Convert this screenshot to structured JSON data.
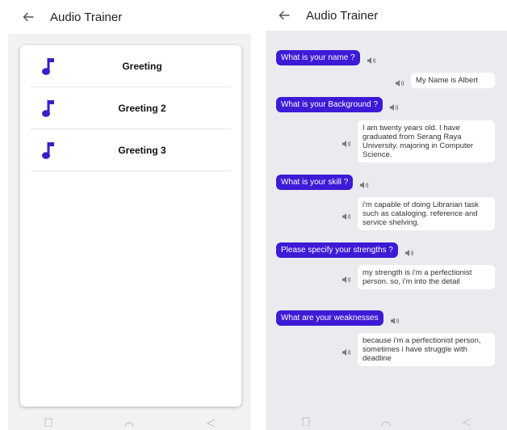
{
  "colors": {
    "accent": "#3d1ad6",
    "bubble_text": "#ffffff",
    "note_icon": "#3a1ec8"
  },
  "left_screen": {
    "title": "Audio Trainer",
    "back_icon": "arrow-left-icon",
    "items": [
      {
        "label": "Greeting",
        "icon": "music-note-icon"
      },
      {
        "label": "Greeting 2",
        "icon": "music-note-icon"
      },
      {
        "label": "Greeting 3",
        "icon": "music-note-icon"
      }
    ]
  },
  "right_screen": {
    "title": "Audio Trainer",
    "back_icon": "arrow-left-icon",
    "speaker_icon": "speaker-icon",
    "dialog": [
      {
        "question": "What is your name ?",
        "answer": "My Name is Albert"
      },
      {
        "question": "What is your Background ?",
        "answer": "I am twenty  years old. I have graduated from Serang Raya University. majoring in Computer Science."
      },
      {
        "question": "What is your skill ?",
        "answer": "i'm capable of doing Librarian task such as cataloging. reference and service shelving."
      },
      {
        "question": "Please specify your strengths ?",
        "answer": "my strength is i'm a perfectionist person. so,  i'm into the detail"
      },
      {
        "question": "What are your weaknesses",
        "answer": "because i'm a perfectionist person, sometimes i have struggle with deadline"
      }
    ]
  },
  "navbar_icons": [
    "square-icon",
    "circle-icon",
    "triangle-back-icon"
  ]
}
